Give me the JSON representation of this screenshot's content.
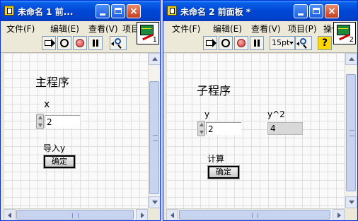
{
  "colors": {
    "titlebar": "#0054e3",
    "panel_bg": "#fafafa",
    "panel_grid": "#e0e0e0",
    "indicator_bg": "#d8d8d8",
    "stop_button": "#d53030"
  },
  "window1": {
    "title": "未命名 1 前...",
    "menu": [
      "文件(F)",
      "编辑(E)",
      "查看(V)",
      "项目"
    ],
    "vi_icon_number": "1",
    "panel": {
      "heading": "主程序",
      "control_label": "x",
      "control_value": "2",
      "button_caption": "导入y",
      "button_text": "确定"
    }
  },
  "window2": {
    "title": "未命名 2 前面板 *",
    "menu": [
      "文件(F)",
      "编辑(E)",
      "查看(V)",
      "项目(P)",
      "操作"
    ],
    "font_size": "15pt",
    "vi_icon_number": "2",
    "panel": {
      "heading": "子程序",
      "control_label": "y",
      "control_value": "2",
      "indicator_label": "y^2",
      "indicator_value": "4",
      "button_caption": "计算",
      "button_text": "确定"
    }
  },
  "icons": {
    "run": "run-arrow-icon",
    "run_continuously": "run-continuously-icon",
    "abort": "stop-icon",
    "pause": "pause-icon",
    "zoom": "zoom-icon",
    "help": "help-icon"
  }
}
